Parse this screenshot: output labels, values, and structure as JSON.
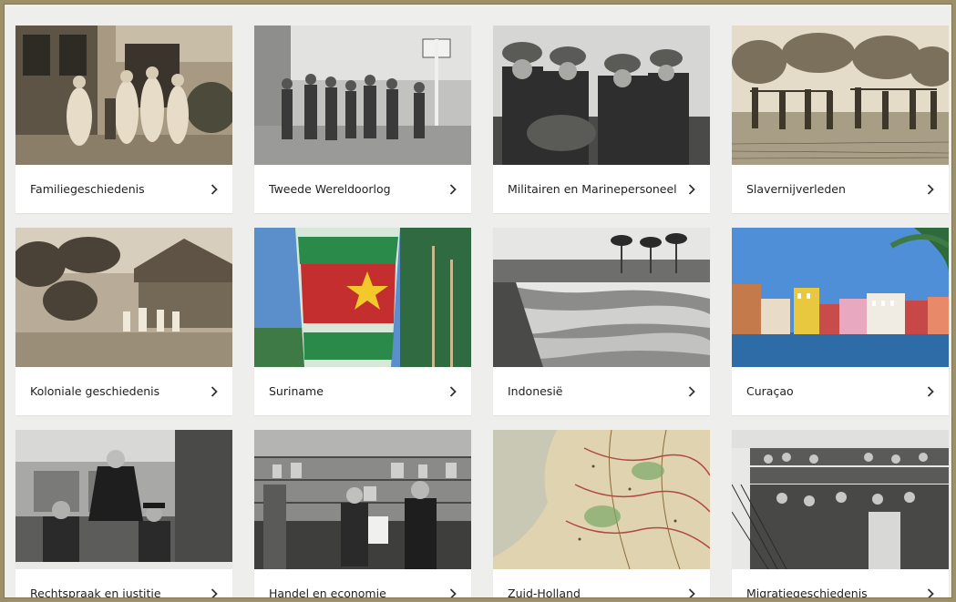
{
  "topics": [
    {
      "label": "Familiegeschiedenis",
      "image": "family-portrait-photo"
    },
    {
      "label": "Tweede Wereldoorlog",
      "image": "soldiers-street-photo"
    },
    {
      "label": "Militairen en Marinepersoneel",
      "image": "helmeted-soldiers-photo"
    },
    {
      "label": "Slavernijverleden",
      "image": "engraving-procession"
    },
    {
      "label": "Koloniale geschiedenis",
      "image": "colonial-house-photo"
    },
    {
      "label": "Suriname",
      "image": "painted-flag-pole-photo"
    },
    {
      "label": "Indonesië",
      "image": "rice-terraces-photo"
    },
    {
      "label": "Curaçao",
      "image": "colorful-waterfront-photo"
    },
    {
      "label": "Rechtspraak en justitie",
      "image": "courtroom-photo"
    },
    {
      "label": "Handel en economie",
      "image": "shop-interior-photo"
    },
    {
      "label": "Zuid-Holland",
      "image": "antique-map"
    },
    {
      "label": "Migratiegeschiedenis",
      "image": "ship-passengers-photo"
    }
  ],
  "icons": {
    "chevron": "chevron-right-icon"
  },
  "colors": {
    "card": "#ffffff",
    "text": "#222222",
    "background": "#eeeeec",
    "outer": "#9c9068"
  }
}
